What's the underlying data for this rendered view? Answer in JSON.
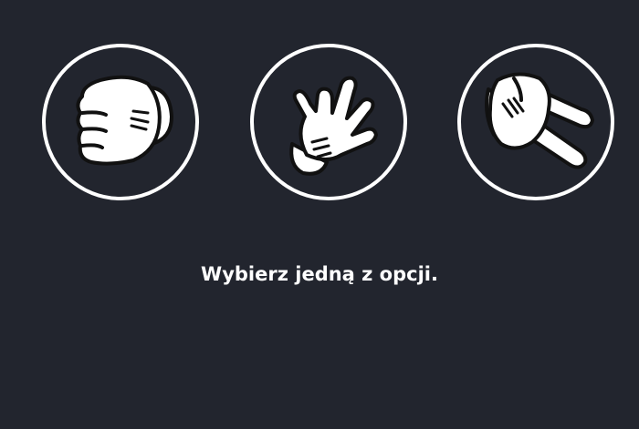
{
  "game": {
    "choices": [
      {
        "id": "rock",
        "icon": "fist-glove-icon"
      },
      {
        "id": "paper",
        "icon": "open-hand-glove-icon"
      },
      {
        "id": "scissors",
        "icon": "scissors-glove-icon"
      }
    ],
    "prompt": "Wybierz jedną z opcji."
  },
  "colors": {
    "background": "#22252e",
    "ring": "#ffffff",
    "glove": "#ffffff",
    "outline": "#111111",
    "text": "#ffffff"
  }
}
